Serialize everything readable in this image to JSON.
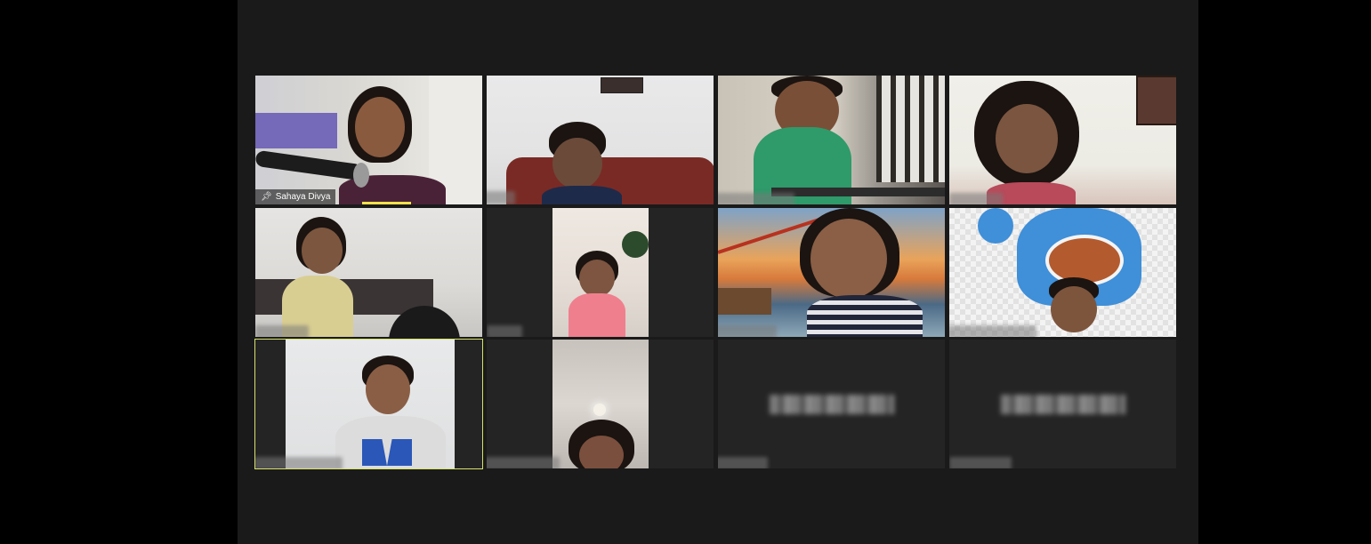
{
  "meeting": {
    "participants": [
      {
        "name": "Sahaya Divya",
        "pinned": true
      },
      {
        "name": ""
      },
      {
        "name": ""
      },
      {
        "name": ""
      },
      {
        "name": ""
      },
      {
        "name": ""
      },
      {
        "name": ""
      },
      {
        "name": ""
      },
      {
        "name": "",
        "active_speaker": true
      },
      {
        "name": ""
      },
      {
        "name": "",
        "video_off": true
      },
      {
        "name": "",
        "video_off": true
      }
    ],
    "icons": {
      "pin": "pin-icon"
    },
    "colors": {
      "active_speaker_border": "#d5e36b"
    }
  }
}
